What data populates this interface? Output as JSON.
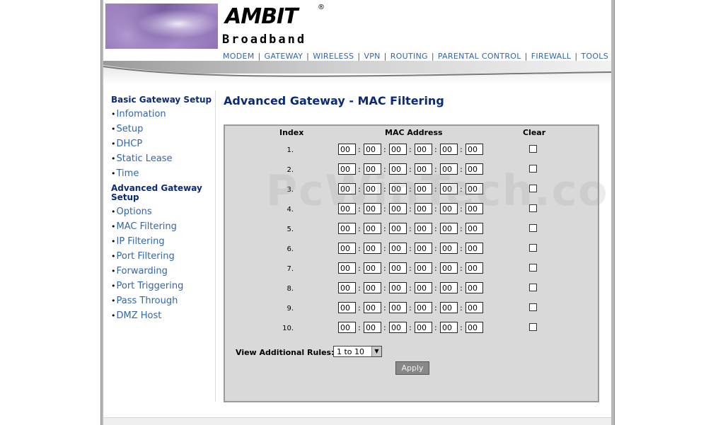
{
  "brand": {
    "logo_text": "AMBIT",
    "reg_mark": "®",
    "sub_text": "Broadband"
  },
  "topnav": [
    "MODEM",
    "GATEWAY",
    "WIRELESS",
    "VPN",
    "ROUTING",
    "PARENTAL CONTROL",
    "FIREWALL",
    "TOOLS"
  ],
  "sidebar": {
    "basic_title": "Basic Gateway Setup",
    "basic_items": [
      "Infomation",
      "Setup",
      "DHCP",
      "Static Lease",
      "Time"
    ],
    "advanced_title": "Advanced Gateway Setup",
    "advanced_items": [
      "Options",
      "MAC Filtering",
      "IP Filtering",
      "Port Filtering",
      "Forwarding",
      "Port Triggering",
      "Pass Through",
      "DMZ Host"
    ]
  },
  "page_title": "Advanced Gateway - MAC Filtering",
  "table": {
    "headers": {
      "index": "Index",
      "mac": "MAC Address",
      "clear": "Clear"
    },
    "rows": [
      "1.",
      "2.",
      "3.",
      "4.",
      "5.",
      "6.",
      "7.",
      "8.",
      "9.",
      "10."
    ],
    "octet_value": "00"
  },
  "view_rules": {
    "label": "View Additional Rules:",
    "selected": "1 to 10"
  },
  "apply_label": "Apply",
  "watermark": "PcWinTech.com",
  "colors": {
    "nav_link": "#3366aa",
    "heading": "#0a2a7a",
    "panel_bg": "#d9d9d9"
  }
}
